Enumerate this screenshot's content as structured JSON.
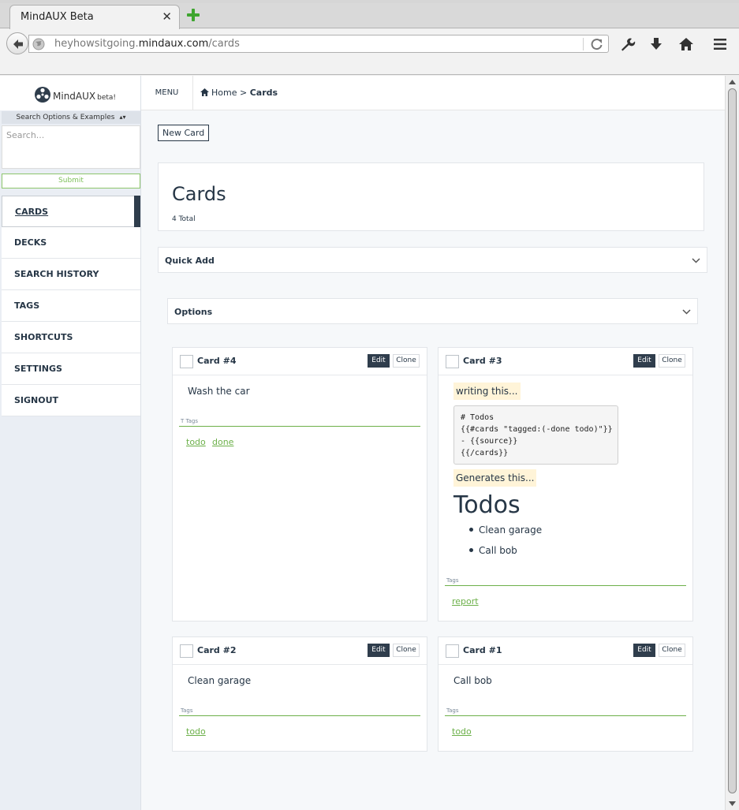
{
  "browser": {
    "tab_title": "MindAUX Beta",
    "url_prefix": "heyhowsitgoing.",
    "url_host": "mindaux.com",
    "url_path": "/cards"
  },
  "sidebar": {
    "brand_name": "MindAUX",
    "brand_tag": "beta!",
    "search_options_label": "Search Options & Examples",
    "search_placeholder": "Search...",
    "submit_label": "Submit",
    "items": [
      {
        "label": "CARDS",
        "active": true
      },
      {
        "label": "DECKS"
      },
      {
        "label": "SEARCH HISTORY"
      },
      {
        "label": "TAGS"
      },
      {
        "label": "SHORTCUTS"
      },
      {
        "label": "SETTINGS"
      },
      {
        "label": "SIGNOUT"
      }
    ]
  },
  "topbar": {
    "menu_label": "MENU",
    "breadcrumb_home": "Home",
    "breadcrumb_sep": ">",
    "breadcrumb_current": "Cards"
  },
  "main": {
    "new_card_label": "New Card",
    "title": "Cards",
    "total": "4 Total",
    "quick_add_label": "Quick Add",
    "options_label": "Options"
  },
  "card_buttons": {
    "edit": "Edit",
    "clone": "Clone"
  },
  "cards": [
    {
      "title": "Card #4",
      "body": "Wash the car",
      "tags_label": "T Tags",
      "tags": [
        "todo",
        "done"
      ]
    },
    {
      "title": "Card #3",
      "intro": "writing this...",
      "code": "# Todos\n{{#cards \"tagged:(-done todo)\"}}\n- {{source}}\n{{/cards}}",
      "outro": "Generates this...",
      "heading": "Todos",
      "list": [
        "Clean garage",
        "Call bob"
      ],
      "tags_label": "Tags",
      "tags": [
        "report"
      ]
    },
    {
      "title": "Card #2",
      "body": "Clean garage",
      "tags_label": "Tags",
      "tags": [
        "todo"
      ]
    },
    {
      "title": "Card #1",
      "body": "Call bob",
      "tags_label": "Tags",
      "tags": [
        "todo"
      ]
    }
  ],
  "colors": {
    "accent_green": "#6cb049",
    "dark_navy": "#2f3d4c",
    "highlight": "#fff4d8"
  },
  "icons": [
    "back-arrow-icon",
    "globe-icon",
    "reload-icon",
    "wrench-icon",
    "download-icon",
    "home-icon",
    "hamburger-menu-icon",
    "new-tab-plus-icon",
    "close-tab-icon",
    "chevron-down-icon",
    "mindaux-logo-icon"
  ]
}
